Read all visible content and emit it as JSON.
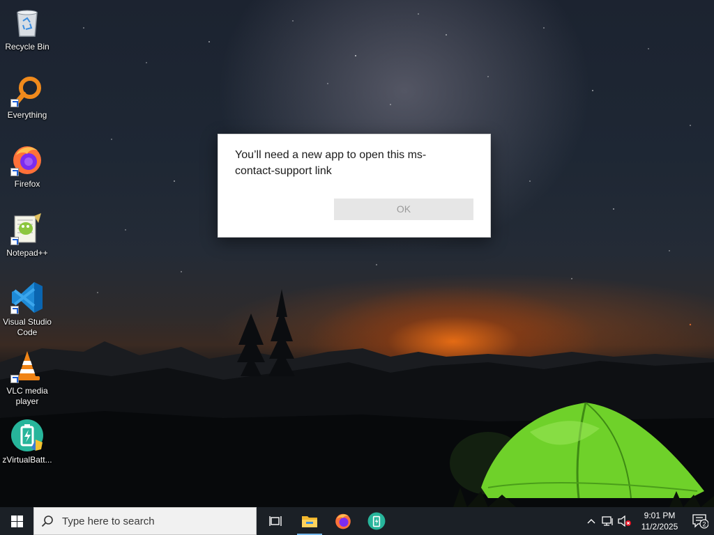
{
  "desktop": {
    "icons": [
      {
        "label": "Recycle Bin",
        "icon": "recycle-bin-icon"
      },
      {
        "label": "Everything",
        "icon": "everything-search-icon"
      },
      {
        "label": "Firefox",
        "icon": "firefox-icon"
      },
      {
        "label": "Notepad++",
        "icon": "notepad-plus-plus-icon"
      },
      {
        "label": "Visual Studio Code",
        "icon": "vscode-icon"
      },
      {
        "label": "VLC media player",
        "icon": "vlc-icon"
      },
      {
        "label": "zVirtualBatt...",
        "icon": "zvirtualbattery-icon"
      }
    ]
  },
  "dialog": {
    "message": "You’ll need a new app to open this ms-contact-support link",
    "ok_label": "OK"
  },
  "taskbar": {
    "search_placeholder": "Type here to search",
    "pinned": [
      "task-view-icon",
      "file-explorer-icon",
      "firefox-icon",
      "zvirtualbattery-icon"
    ],
    "clock": {
      "time": "9:01 PM",
      "date": "11/2/2025"
    },
    "notification_count": "2"
  },
  "colors": {
    "taskbar": "#1b2026",
    "dialog_bg": "#ffffff",
    "ok_button_bg": "#e6e6e6",
    "accent": "#76b9ed"
  }
}
